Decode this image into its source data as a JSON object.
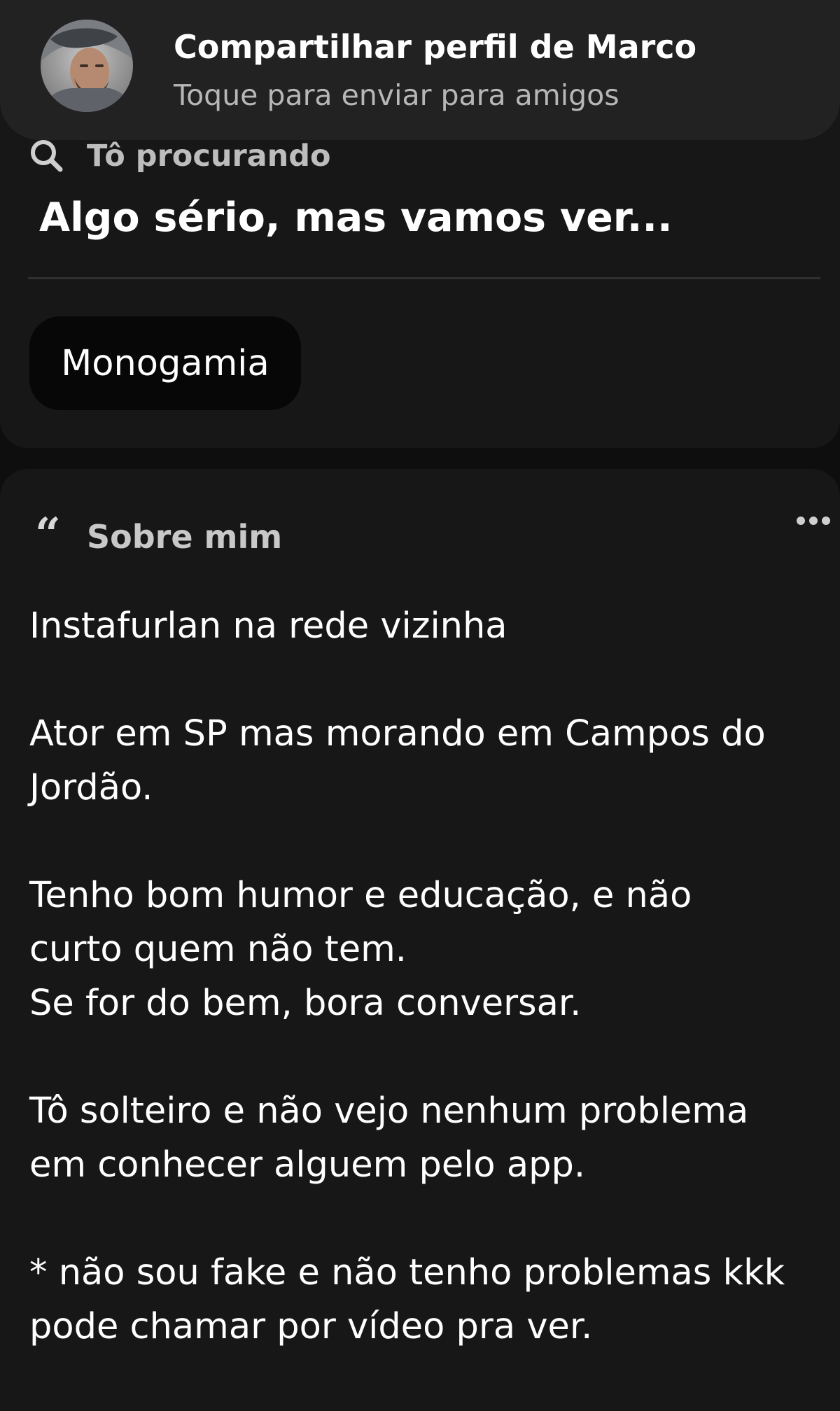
{
  "share": {
    "title": "Compartilhar perfil de Marco",
    "subtitle": "Toque para enviar para amigos"
  },
  "looking_for": {
    "label": "Tô procurando",
    "value": "Algo sério, mas vamos ver...",
    "tag": "Monogamia"
  },
  "about": {
    "title": "Sobre mim",
    "paragraphs": [
      "Instafurlan na rede vizinha",
      "Ator em SP mas morando em Campos do\nJordão.",
      "Tenho bom humor e educação, e não\ncurto quem não tem.\nSe for do bem, bora conversar.",
      "Tô solteiro e não vejo nenhum problema\nem conhecer alguem pelo app.",
      " * não sou fake e não tenho problemas kkk\npode chamar por vídeo pra ver."
    ]
  },
  "icons": {
    "search": "search-icon",
    "quote": "quote-icon",
    "more": "more-options-icon"
  },
  "colors": {
    "background": "#0e0e0e",
    "card": "#171717",
    "banner": "#222222",
    "chip": "#070707"
  }
}
